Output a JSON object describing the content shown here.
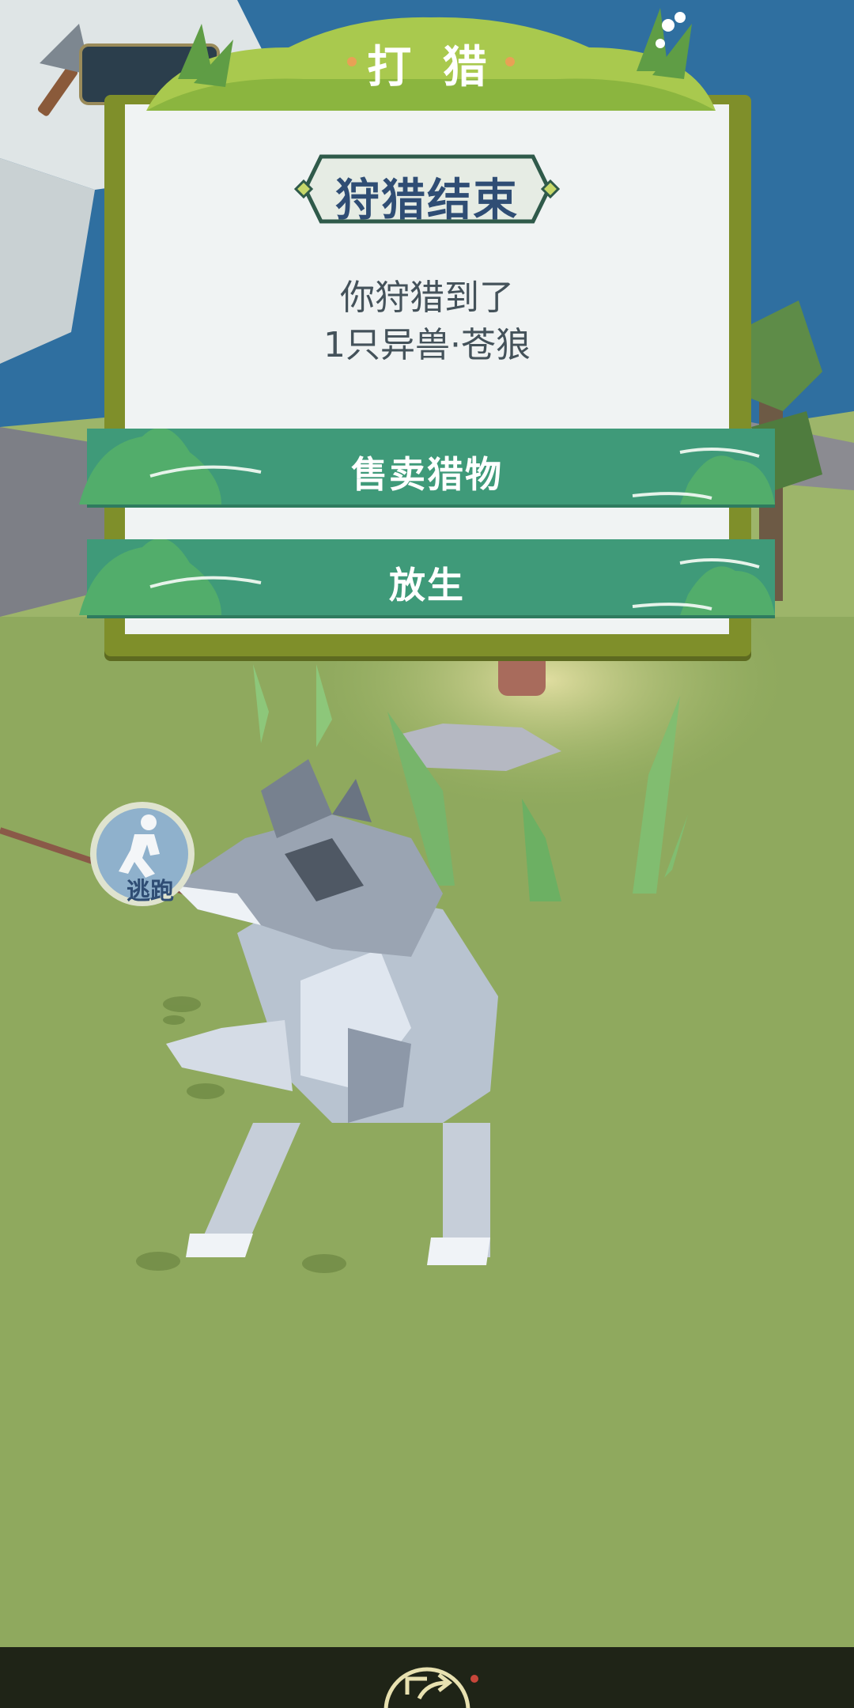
{
  "modal": {
    "header_title": "打 猎",
    "result_title": "狩猎结束",
    "result_line1": "你狩猎到了",
    "result_line2": "1只异兽·苍狼"
  },
  "actions": {
    "sell_label": "售卖猎物",
    "release_label": "放生"
  },
  "hud": {
    "escape_label": "逃跑"
  },
  "colors": {
    "panel_border": "#7f8f2a",
    "button_green": "#3f9a79",
    "title_text": "#2f4d74",
    "grass": "#8fa95e",
    "sky": "#2f6fa0"
  }
}
